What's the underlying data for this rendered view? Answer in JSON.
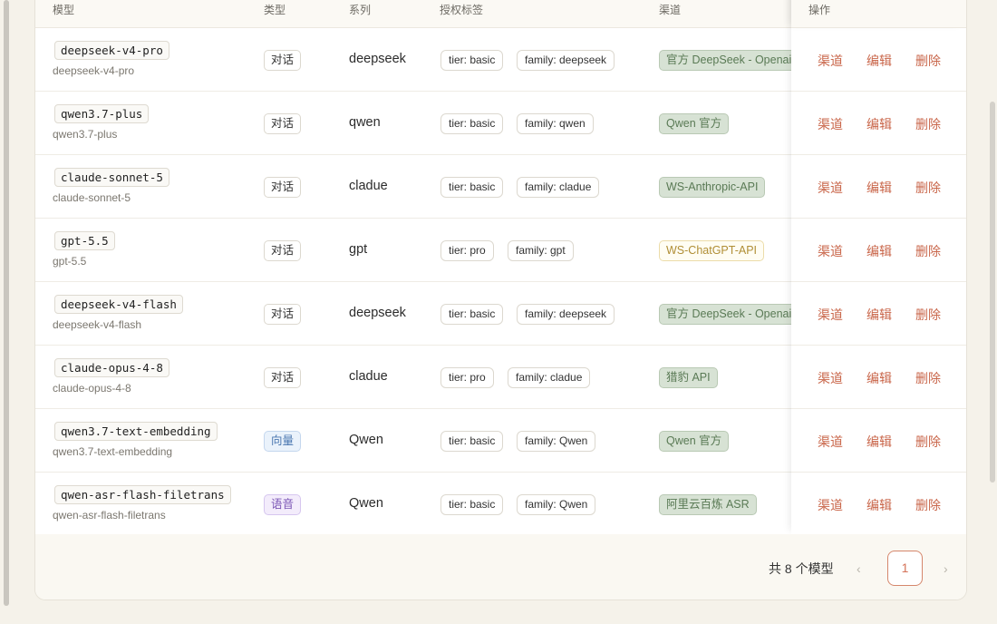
{
  "headers": {
    "model": "模型",
    "type": "类型",
    "series": "系列",
    "auth": "授权标签",
    "channel": "渠道",
    "ops": "操作"
  },
  "rows": [
    {
      "code": "deepseek-v4-pro",
      "sub": "deepseek-v4-pro",
      "type": "对话",
      "type_kind": "chat",
      "series": "deepseek",
      "tier": "tier: basic",
      "family": "family: deepseek",
      "channel": "官方 DeepSeek - Openai",
      "channel_kind": "green"
    },
    {
      "code": "qwen3.7-plus",
      "sub": "qwen3.7-plus",
      "type": "对话",
      "type_kind": "chat",
      "series": "qwen",
      "tier": "tier: basic",
      "family": "family: qwen",
      "channel": "Qwen 官方",
      "channel_kind": "green"
    },
    {
      "code": "claude-sonnet-5",
      "sub": "claude-sonnet-5",
      "type": "对话",
      "type_kind": "chat",
      "series": "cladue",
      "tier": "tier: basic",
      "family": "family: cladue",
      "channel": "WS-Anthropic-API",
      "channel_kind": "green"
    },
    {
      "code": "gpt-5.5",
      "sub": "gpt-5.5",
      "type": "对话",
      "type_kind": "chat",
      "series": "gpt",
      "tier": "tier: pro",
      "family": "family: gpt",
      "channel": "WS-ChatGPT-API",
      "channel_kind": "gold"
    },
    {
      "code": "deepseek-v4-flash",
      "sub": "deepseek-v4-flash",
      "type": "对话",
      "type_kind": "chat",
      "series": "deepseek",
      "tier": "tier: basic",
      "family": "family: deepseek",
      "channel": "官方 DeepSeek - Openai",
      "channel_kind": "green"
    },
    {
      "code": "claude-opus-4-8",
      "sub": "claude-opus-4-8",
      "type": "对话",
      "type_kind": "chat",
      "series": "cladue",
      "tier": "tier: pro",
      "family": "family: cladue",
      "channel": "猎豹 API",
      "channel_kind": "green"
    },
    {
      "code": "qwen3.7-text-embedding",
      "sub": "qwen3.7-text-embedding",
      "type": "向量",
      "type_kind": "vector",
      "series": "Qwen",
      "tier": "tier: basic",
      "family": "family: Qwen",
      "channel": "Qwen 官方",
      "channel_kind": "green"
    },
    {
      "code": "qwen-asr-flash-filetrans",
      "sub": "qwen-asr-flash-filetrans",
      "type": "语音",
      "type_kind": "voice",
      "series": "Qwen",
      "tier": "tier: basic",
      "family": "family: Qwen",
      "channel": "阿里云百炼 ASR",
      "channel_kind": "green"
    }
  ],
  "actions": {
    "channel": "渠道",
    "edit": "编辑",
    "delete": "删除"
  },
  "pagination": {
    "total": "共 8 个模型",
    "prev": "‹",
    "current": "1",
    "next": "›"
  }
}
